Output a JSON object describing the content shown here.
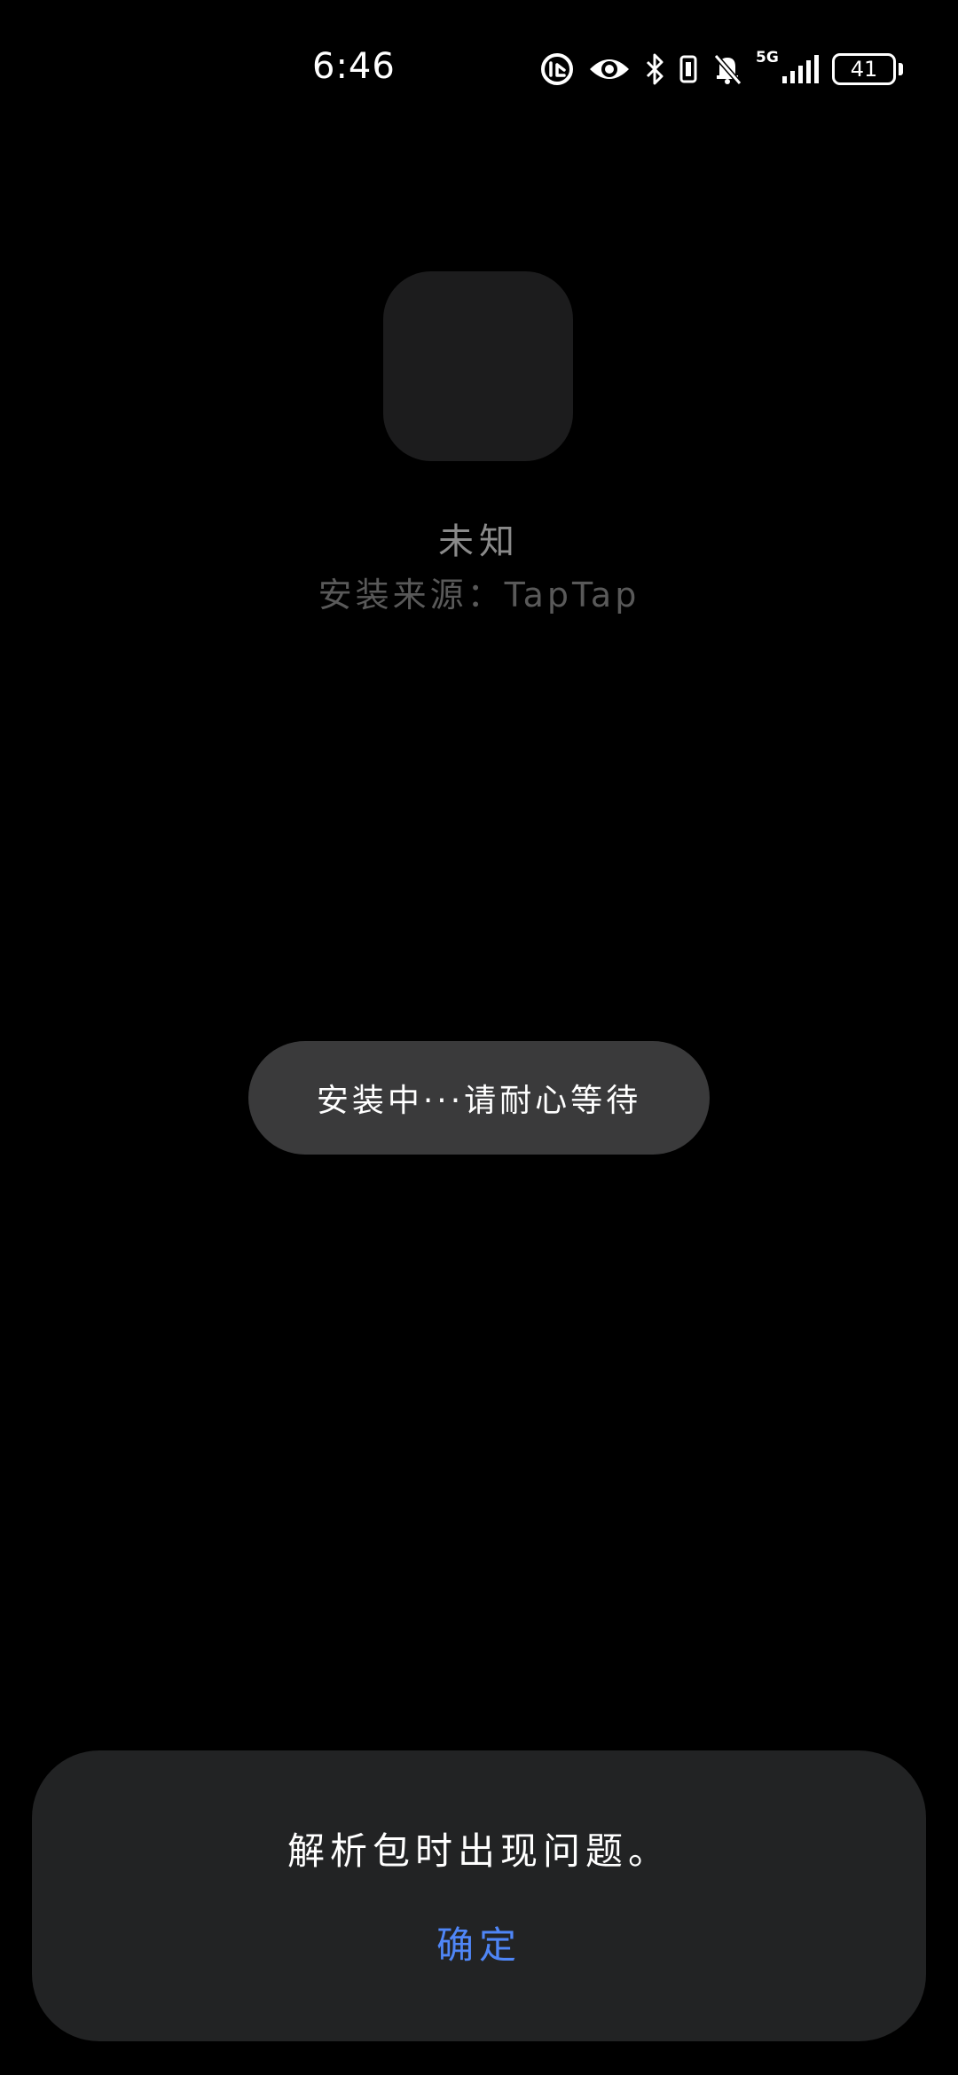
{
  "status_bar": {
    "time": "6:46",
    "network_label": "5G",
    "battery_level": "41",
    "icons": [
      "data-saver-icon",
      "eye-comfort-icon",
      "bluetooth-icon",
      "vibrate-icon",
      "mute-bell-icon",
      "signal-icon",
      "battery-icon"
    ]
  },
  "app": {
    "name": "未知",
    "source": "安装来源：TapTap"
  },
  "toast": {
    "text": "安装中···请耐心等待"
  },
  "dialog": {
    "message": "解析包时出现问题。",
    "confirm_label": "确定"
  },
  "colors": {
    "background": "#000000",
    "dialog_bg": "#222324",
    "pill_bg": "#3a3a3b",
    "accent": "#4f86f7"
  }
}
